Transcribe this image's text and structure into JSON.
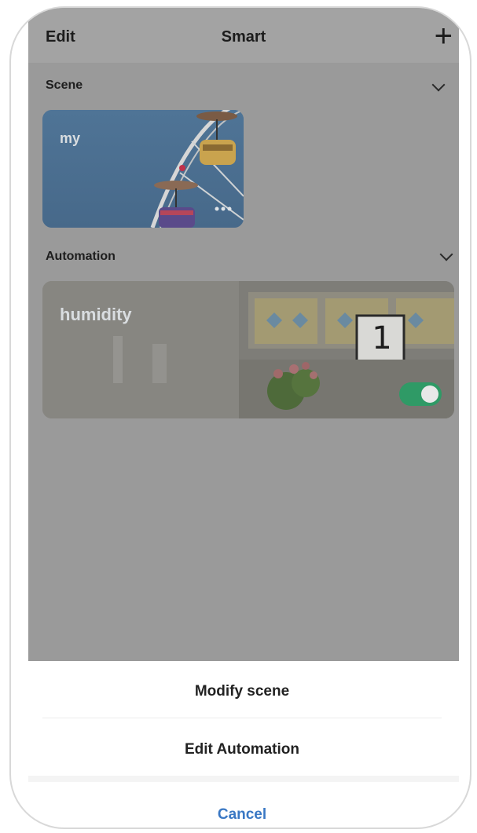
{
  "header": {
    "edit_label": "Edit",
    "title": "Smart",
    "add_icon": "plus-icon"
  },
  "sections": {
    "scene": {
      "label": "Scene",
      "chevron_icon": "chevron-down-icon"
    },
    "automation": {
      "label": "Automation",
      "chevron_icon": "chevron-down-icon"
    }
  },
  "scene_card": {
    "name": "my",
    "more_icon": "more-dots-icon"
  },
  "automation_card": {
    "name": "humidity",
    "sign_number": "1",
    "enabled": true
  },
  "action_sheet": {
    "modify_scene": "Modify scene",
    "edit_automation": "Edit Automation",
    "cancel": "Cancel"
  },
  "colors": {
    "overlay": "#9a9a9a",
    "toggle_on": "#2f9a66",
    "cancel_text": "#3a78c4"
  }
}
